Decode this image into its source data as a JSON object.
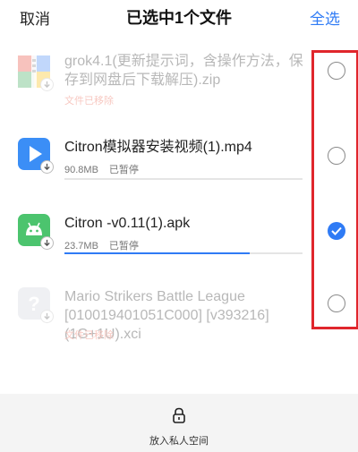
{
  "header": {
    "cancel_label": "取消",
    "title": "已选中1个文件",
    "select_all_label": "全选"
  },
  "files": [
    {
      "name": "grok4.1(更新提示词，含操作方法，保存到网盘后下载解压).zip",
      "status": "文件已移除",
      "selected": false,
      "icon": "zip-archive-icon"
    },
    {
      "name": "Citron模拟器安装视频(1).mp4",
      "size": "90.8MB",
      "status": "已暂停",
      "progress": 0.0,
      "selected": false,
      "icon": "video-file-icon"
    },
    {
      "name": "Citron -v0.11(1).apk",
      "size": "23.7MB",
      "status": "已暂停",
      "progress": 0.78,
      "selected": true,
      "icon": "android-apk-icon"
    },
    {
      "name": "Mario Strikers Battle League [010019401051C000] [v393216] (1G+1U).xci",
      "status": "文件已移除",
      "selected": false,
      "icon": "unknown-file-icon"
    }
  ],
  "bottom_bar": {
    "private_space_label": "放入私人空间",
    "icon": "lock-icon"
  },
  "colors": {
    "accent": "#2f7bf5",
    "removed": "#e8553f",
    "highlight_box": "#e0262c"
  }
}
